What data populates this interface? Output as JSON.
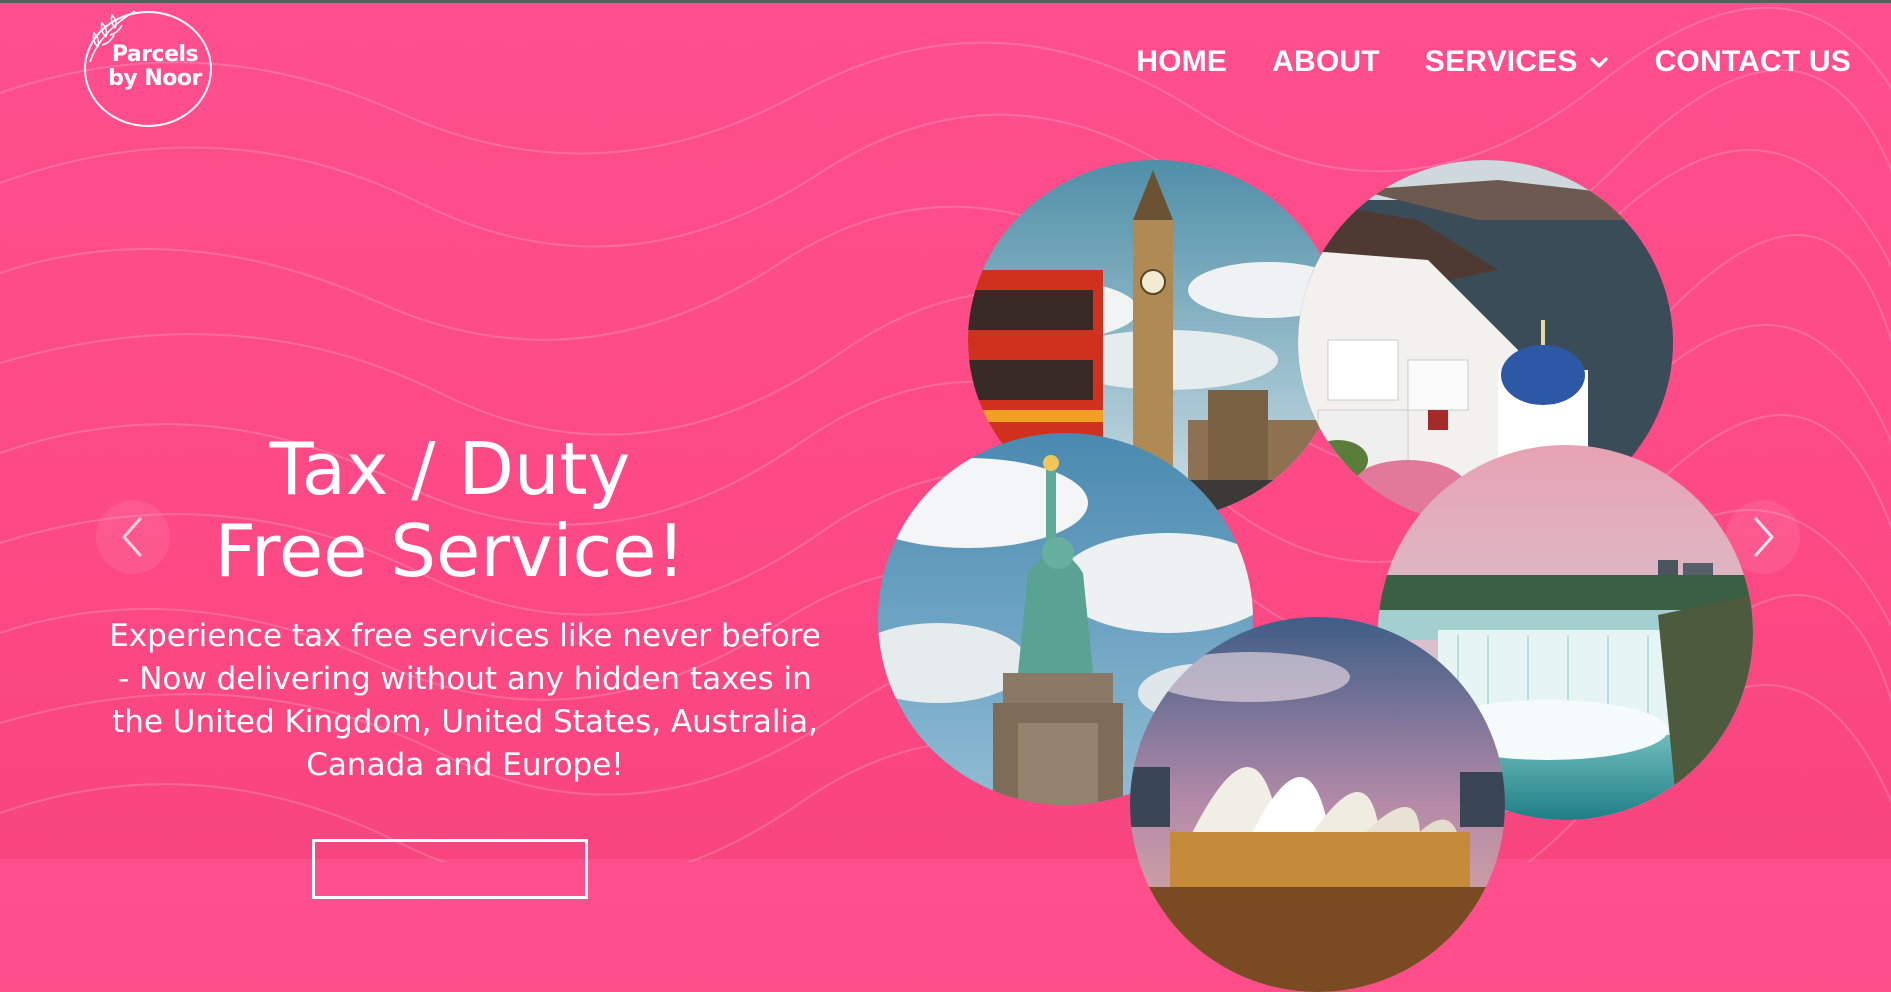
{
  "brand": {
    "logo_line1": "Parcels",
    "logo_line2": "by Noor"
  },
  "nav": {
    "items": [
      {
        "label": "HOME"
      },
      {
        "label": "ABOUT"
      },
      {
        "label": "SERVICES",
        "has_dropdown": true
      },
      {
        "label": "CONTACT US"
      }
    ]
  },
  "hero": {
    "title_line1": "Tax / Duty",
    "title_line2": "Free Service!",
    "description": "Experience tax free services like never before - Now delivering without any hidden taxes in the United Kingdom, United States, Australia, Canada and Europe!"
  },
  "carousel": {
    "prev_icon": "chevron-left-icon",
    "next_icon": "chevron-right-icon"
  },
  "images": [
    {
      "name": "london-big-ben-photo"
    },
    {
      "name": "santorini-photo"
    },
    {
      "name": "statue-of-liberty-photo"
    },
    {
      "name": "niagara-falls-photo"
    },
    {
      "name": "sydney-opera-house-photo"
    }
  ],
  "colors": {
    "background": "#ff4f8c",
    "text": "#ffffff"
  }
}
